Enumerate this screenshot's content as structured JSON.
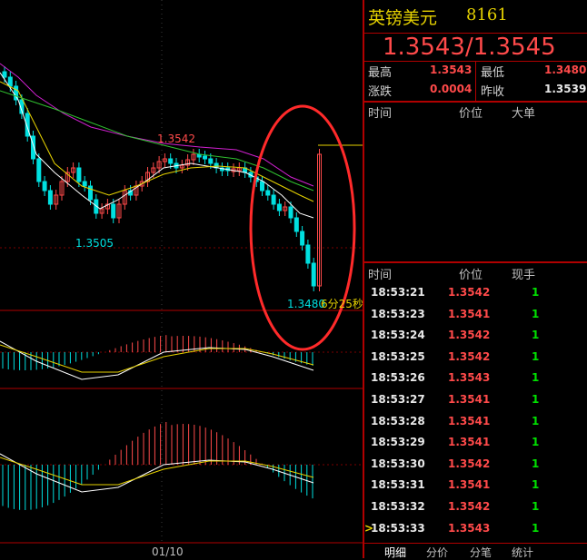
{
  "instrument": {
    "name": "英镑美元",
    "code": "8161",
    "bid_ask": "1.3543/1.3545"
  },
  "stats": {
    "high_label": "最高",
    "high": "1.3543",
    "low_label": "最低",
    "low": "1.3480",
    "change_label": "涨跌",
    "change": "0.0004",
    "prev_close_label": "昨收",
    "prev_close": "1.3539"
  },
  "big_orders": {
    "col_time": "时间",
    "col_price": "价位",
    "col_big": "大单"
  },
  "trades": {
    "col_time": "时间",
    "col_price": "价位",
    "col_qty": "现手",
    "rows": [
      {
        "time": "18:53:21",
        "price": "1.3542",
        "qty": "1"
      },
      {
        "time": "18:53:23",
        "price": "1.3541",
        "qty": "1"
      },
      {
        "time": "18:53:24",
        "price": "1.3542",
        "qty": "1"
      },
      {
        "time": "18:53:25",
        "price": "1.3542",
        "qty": "1"
      },
      {
        "time": "18:53:26",
        "price": "1.3543",
        "qty": "1"
      },
      {
        "time": "18:53:27",
        "price": "1.3541",
        "qty": "1"
      },
      {
        "time": "18:53:28",
        "price": "1.3541",
        "qty": "1"
      },
      {
        "time": "18:53:29",
        "price": "1.3541",
        "qty": "1"
      },
      {
        "time": "18:53:30",
        "price": "1.3542",
        "qty": "1"
      },
      {
        "time": "18:53:31",
        "price": "1.3541",
        "qty": "1"
      },
      {
        "time": "18:53:32",
        "price": "1.3542",
        "qty": "1"
      },
      {
        "time": "18:53:33",
        "price": "1.3543",
        "qty": "1"
      }
    ],
    "last_marker": ">"
  },
  "tabs": [
    "明细",
    "分价",
    "分笔",
    "统计"
  ],
  "chart": {
    "high_label": "1.3542",
    "low_label_left": "1.3505",
    "low_label_right": "1.3480",
    "countdown": "6分25秒",
    "date_label": "01/10"
  },
  "colors": {
    "up": "#ff4a4a",
    "down": "#00e0e0",
    "border": "#b00000",
    "title": "#e6d200",
    "annotation": "#ff2a2a"
  }
}
